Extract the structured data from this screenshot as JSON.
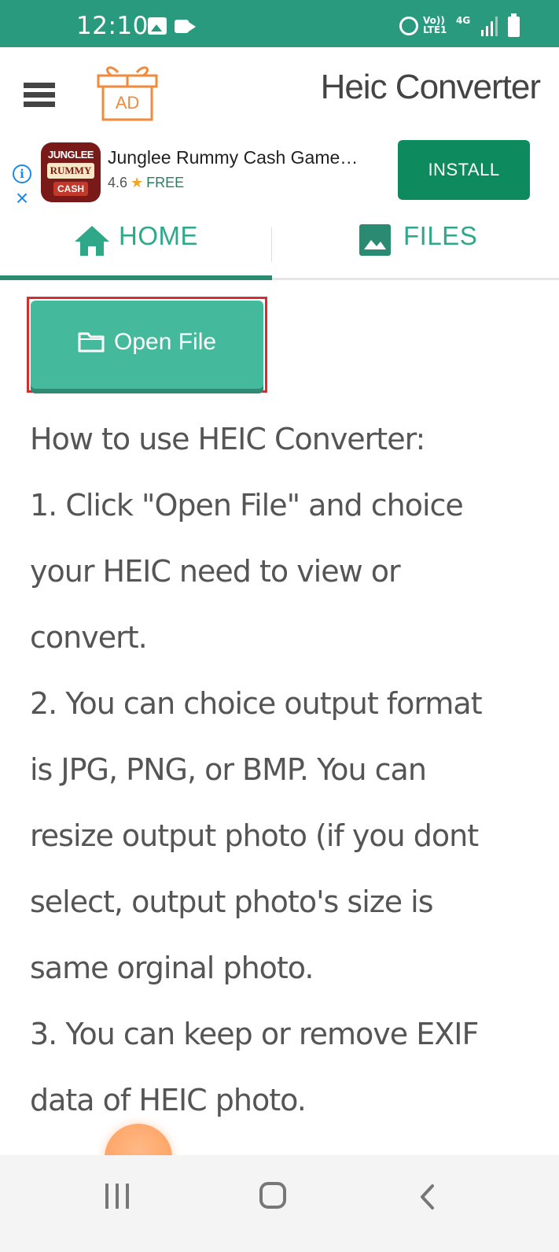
{
  "status_bar": {
    "time": "12:10",
    "lte_label": "Vo)) LTE1",
    "network_label": "4G"
  },
  "toolbar": {
    "title": "Heic Converter",
    "ad_badge": "AD"
  },
  "ad_banner": {
    "app_icon_text": [
      "JUNGLEE",
      "RUMMY",
      "CASH"
    ],
    "app_name": "Junglee Rummy Cash Game…",
    "rating": "4.6",
    "price": "FREE",
    "install_label": "INSTALL"
  },
  "tabs": [
    {
      "label": "HOME",
      "icon": "home-icon",
      "active": true
    },
    {
      "label": "FILES",
      "icon": "image-icon",
      "active": false
    }
  ],
  "main": {
    "open_file_label": "Open File",
    "instructions": [
      "How to use HEIC Converter:",
      "1. Click \"Open File\" and choice",
      "your HEIC need to view or",
      "convert.",
      "2. You can choice output format",
      "is JPG, PNG, or BMP. You can",
      "resize output photo (if you dont",
      "select, output photo's size is",
      "same orginal photo.",
      "3. You can keep or remove EXIF",
      "data of HEIC photo."
    ]
  },
  "colors": {
    "status_bar": "#2a9a7e",
    "accent": "#2fa88a",
    "button": "#45b99c",
    "install": "#0d8a5e",
    "highlight": "#d32f2f"
  }
}
